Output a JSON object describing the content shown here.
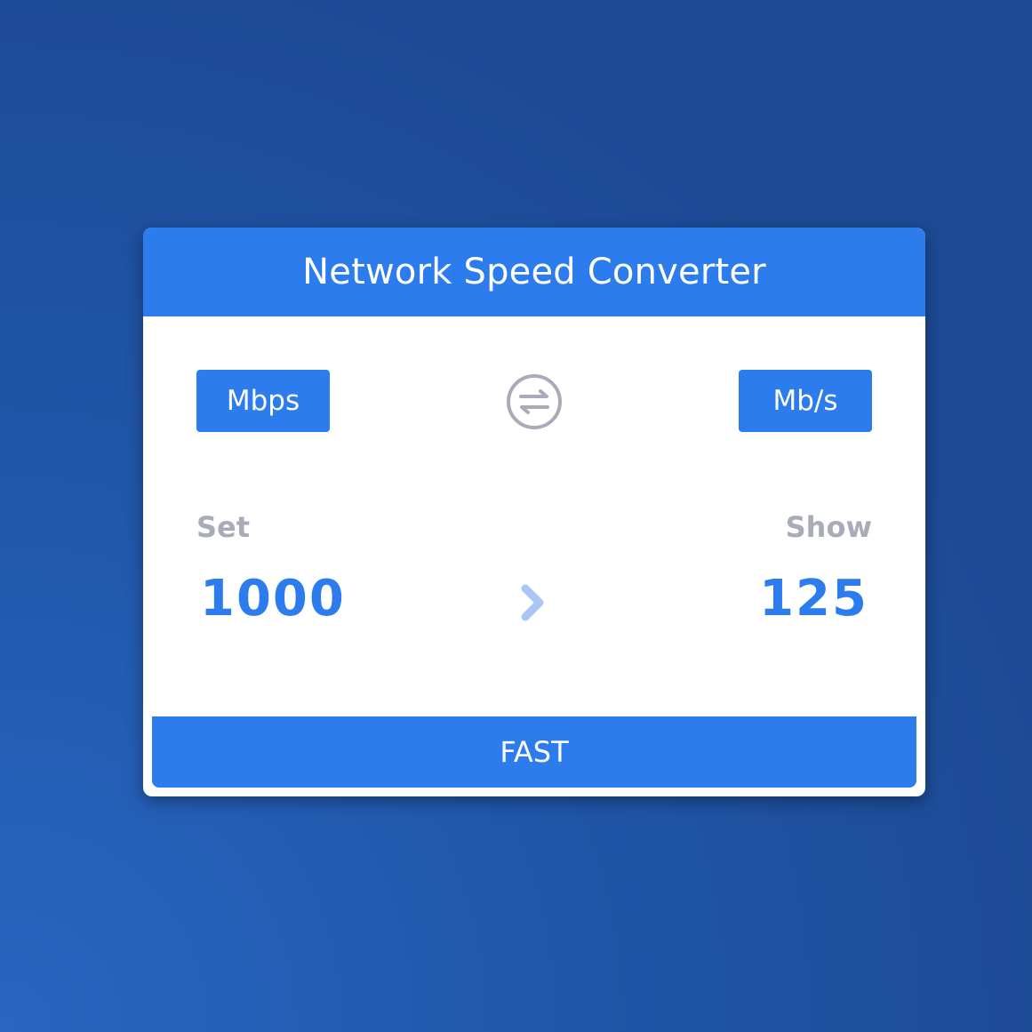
{
  "app": {
    "title": "Network Speed Converter"
  },
  "units": {
    "from": "Mbps",
    "to": "Mb/s"
  },
  "labels": {
    "set": "Set",
    "show": "Show"
  },
  "values": {
    "set": "1000",
    "show": "125"
  },
  "actions": {
    "fast_label": "FAST"
  },
  "icons": {
    "swap": "swap-arrows-icon",
    "arrow": "chevron-right-icon"
  },
  "colors": {
    "accent": "#2d7cee",
    "muted_text": "#a8acb8",
    "icon_gray": "#a8acb8",
    "chevron": "#a9c6f5",
    "background": "#1f4e9b"
  }
}
